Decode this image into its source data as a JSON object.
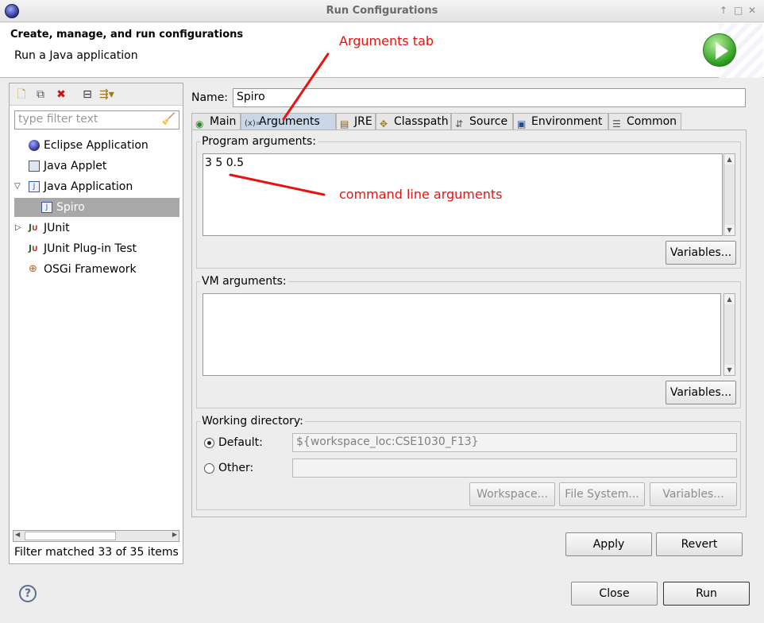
{
  "window": {
    "title": "Run Configurations"
  },
  "header": {
    "title": "Create, manage, and run configurations",
    "subtitle": "Run a Java application"
  },
  "filter": {
    "placeholder": "type filter text",
    "status": "Filter matched 33 of 35 items"
  },
  "tree": [
    {
      "label": "Eclipse Application"
    },
    {
      "label": "Java Applet"
    },
    {
      "label": "Java Application"
    },
    {
      "label": "Spiro"
    },
    {
      "label": "JUnit"
    },
    {
      "label": "JUnit Plug-in Test"
    },
    {
      "label": "OSGi Framework"
    }
  ],
  "config": {
    "name_label": "Name:",
    "name_value": "Spiro"
  },
  "tabs": [
    "Main",
    "Arguments",
    "JRE",
    "Classpath",
    "Source",
    "Environment",
    "Common"
  ],
  "program_args": {
    "label": "Program arguments:",
    "value": "3 5 0.5",
    "variables": "Variables..."
  },
  "vm_args": {
    "label": "VM arguments:",
    "value": "",
    "variables": "Variables..."
  },
  "working_dir": {
    "label": "Working directory:",
    "default_label": "Default:",
    "default_value": "${workspace_loc:CSE1030_F13}",
    "other_label": "Other:",
    "workspace": "Workspace...",
    "file_system": "File System...",
    "variables": "Variables..."
  },
  "actions": {
    "apply": "Apply",
    "revert": "Revert",
    "close": "Close",
    "run": "Run"
  },
  "annotations": {
    "tab": "Arguments tab",
    "args": "command line arguments"
  },
  "colors": {
    "annotation": "#e8120f",
    "selection": "#a8a8a8",
    "active_tab": "#c9d7e6"
  }
}
